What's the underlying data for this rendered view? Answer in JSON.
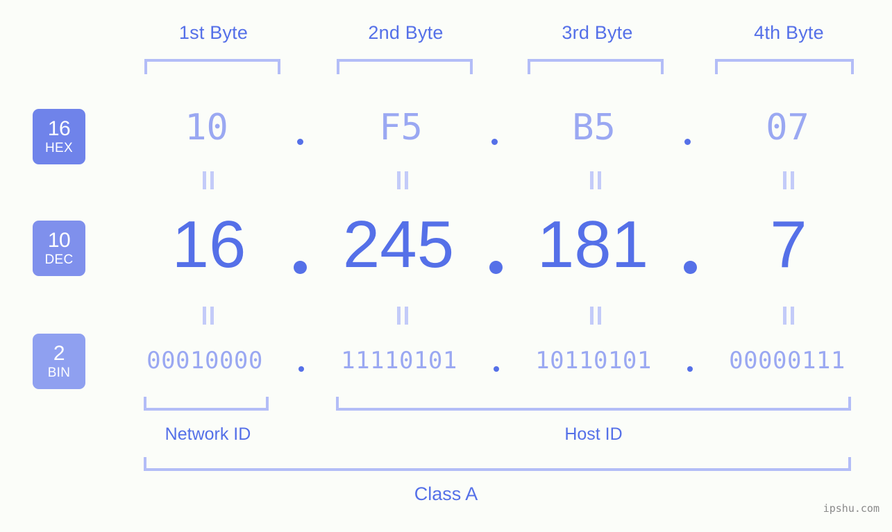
{
  "background_color": "#fbfdf9",
  "accent_color": "#5570e8",
  "light_accent_color": "#9aa8f2",
  "bracket_color": "#b3bdf7",
  "badge_color": "#6f83ea",
  "byte_headers": [
    {
      "label": "1st Byte"
    },
    {
      "label": "2nd Byte"
    },
    {
      "label": "3rd Byte"
    },
    {
      "label": "4th Byte"
    }
  ],
  "bases": [
    {
      "number": "16",
      "name": "HEX"
    },
    {
      "number": "10",
      "name": "DEC"
    },
    {
      "number": "2",
      "name": "BIN"
    }
  ],
  "rows": {
    "hex": {
      "base": "16",
      "name": "HEX",
      "values": [
        "10",
        "F5",
        "B5",
        "07"
      ],
      "address": "10.F5.B5.07"
    },
    "dec": {
      "base": "10",
      "name": "DEC",
      "values": [
        "16",
        "245",
        "181",
        "7"
      ],
      "address": "16.245.181.7"
    },
    "bin": {
      "base": "2",
      "name": "BIN",
      "values": [
        "00010000",
        "11110101",
        "10110101",
        "00000111"
      ],
      "address": "00010000.11110101.10110101.00000111"
    }
  },
  "separator": ".",
  "equality_symbol": "=",
  "segments": {
    "network_id": "Network ID",
    "host_id": "Host ID"
  },
  "class_label": "Class A",
  "watermark": "ipshu.com"
}
